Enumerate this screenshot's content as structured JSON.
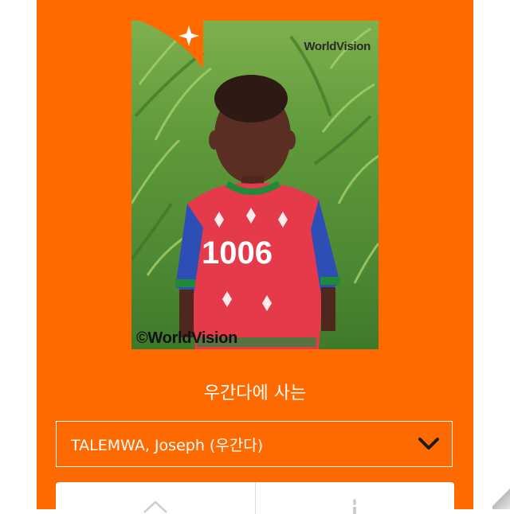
{
  "photo": {
    "logo_text": "WorldVision",
    "copyright_text": "©WorldVision",
    "shirt_number": "1006"
  },
  "profile": {
    "subtitle": "우간다에 사는",
    "child_select_value": "TALEMWA, Joseph (우간다)"
  },
  "icons": {
    "dropdown": "chevron-down-icon",
    "panel_left": "home-icon",
    "panel_right": "candle-icon",
    "logo_star": "sparkle-icon"
  },
  "colors": {
    "brand": "#ff6a00",
    "text_on_brand": "#ffffff"
  }
}
